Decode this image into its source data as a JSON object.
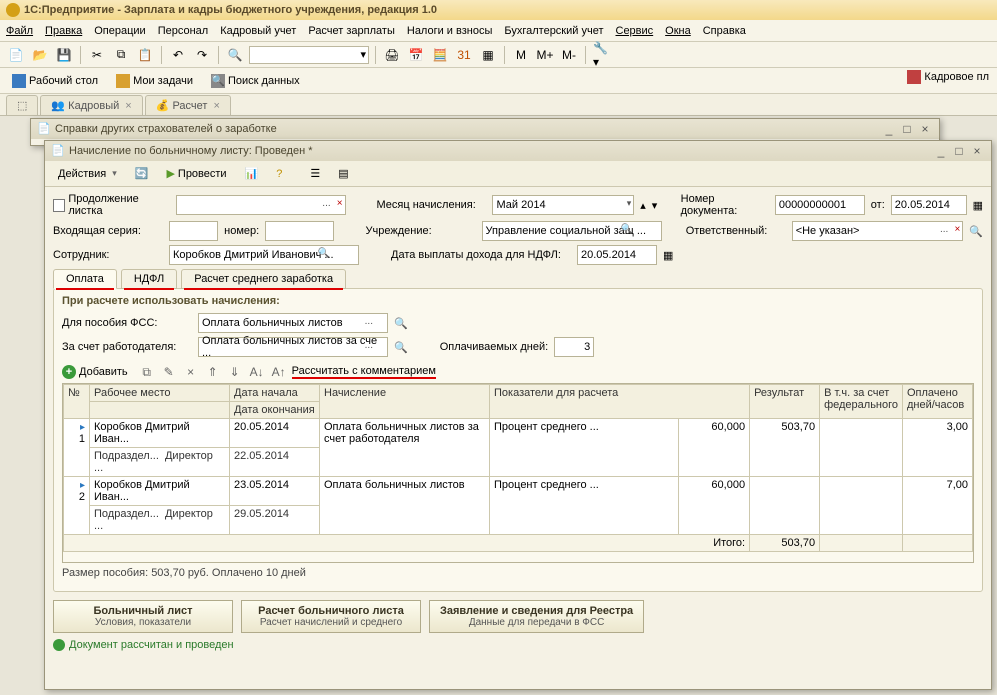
{
  "app_title": "1С:Предприятие - Зарплата и кадры бюджетного учреждения, редакция 1.0",
  "menu": [
    "Файл",
    "Правка",
    "Операции",
    "Персонал",
    "Кадровый учет",
    "Расчет зарплаты",
    "Налоги и взносы",
    "Бухгалтерский учет",
    "Сервис",
    "Окна",
    "Справка"
  ],
  "nav": {
    "desktop": "Рабочий стол",
    "tasks": "Мои задачи",
    "search": "Поиск данных",
    "right": "Кадровое пл"
  },
  "open_tabs": [
    "Кадровый",
    "Расчет"
  ],
  "win1_title": "Справки других страхователей о заработке",
  "win2_title": "Начисление по больничному листу: Проведен *",
  "actions_label": "Действия",
  "post_label": "Провести",
  "form": {
    "cont_label": "Продолжение листка",
    "in_series_label": "Входящая серия:",
    "number_label": "номер:",
    "employee_label": "Сотрудник:",
    "employee_value": "Коробков Дмитрий Иванович ...",
    "month_label": "Месяц начисления:",
    "month_value": "Май 2014",
    "org_label": "Учреждение:",
    "org_value": "Управление социальной защ ...",
    "ndfl_date_label": "Дата выплаты дохода для НДФЛ:",
    "ndfl_date_value": "20.05.2014",
    "docnum_label": "Номер документа:",
    "docnum_value": "00000000001",
    "from_label": "от:",
    "from_value": "20.05.2014",
    "resp_label": "Ответственный:",
    "resp_value": "<Не указан>"
  },
  "inner_tabs": [
    "Оплата",
    "НДФЛ",
    "Расчет среднего заработка"
  ],
  "group_title": "При расчете использовать начисления:",
  "fss_label": "Для пособия ФСС:",
  "fss_value": "Оплата больничных листов",
  "employer_label": "За счет работодателя:",
  "employer_value": "Оплата больничных листов за сче ...",
  "paid_days_label": "Оплачиваемых дней:",
  "paid_days_value": "3",
  "add_label": "Добавить",
  "recalc_label": "Рассчитать с комментарием",
  "grid_headers": {
    "num": "№",
    "workplace": "Рабочее место",
    "date_start": "Дата начала",
    "date_end": "Дата окончания",
    "accrual": "Начисление",
    "indicators": "Показатели для расчета",
    "result": "Результат",
    "federal": "В т.ч. за счет федерального",
    "paid": "Оплачено дней/часов"
  },
  "grid_rows": [
    {
      "n": "1",
      "person": "Коробков Дмитрий Иван...",
      "sub1": "Подраздел...",
      "sub2": "Директор ...",
      "d1": "20.05.2014",
      "d2": "22.05.2014",
      "accr": "Оплата больничных листов за счет работодателя",
      "ind": "Процент среднего ...",
      "indval": "60,000",
      "res": "503,70",
      "fed": "",
      "paid": "3,00"
    },
    {
      "n": "2",
      "person": "Коробков Дмитрий Иван...",
      "sub1": "Подраздел...",
      "sub2": "Директор ...",
      "d1": "23.05.2014",
      "d2": "29.05.2014",
      "accr": "Оплата больничных листов",
      "ind": "Процент среднего ...",
      "indval": "60,000",
      "res": "",
      "fed": "",
      "paid": "7,00"
    }
  ],
  "total_label": "Итого:",
  "total_value": "503,70",
  "footer_info": "Размер пособия: 503,70 руб. Оплачено 10 дней",
  "bottom_buttons": [
    {
      "title": "Больничный лист",
      "sub": "Условия, показатели"
    },
    {
      "title": "Расчет больничного листа",
      "sub": "Расчет начислений и среднего"
    },
    {
      "title": "Заявление и сведения для Реестра",
      "sub": "Данные для передачи в ФСС"
    }
  ],
  "status_ok": "Документ рассчитан и проведен",
  "toolbar_glyphs": {
    "m": "М",
    "mp": "М+",
    "mm": "М-"
  }
}
